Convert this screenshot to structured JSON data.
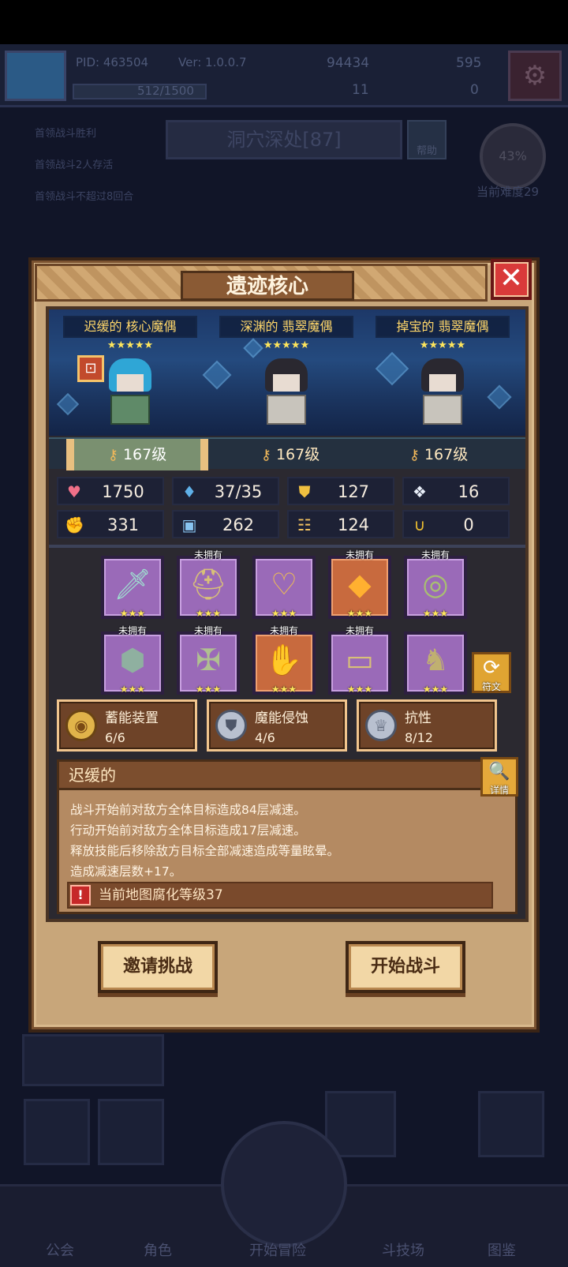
{
  "background": {
    "pid": "PID: 463504",
    "version": "Ver: 1.0.0.7",
    "gold": "94434",
    "gems": "595",
    "exp": "512/1500",
    "keys": "11",
    "tickets": "0",
    "quests": [
      "首领战斗胜利",
      "首领战斗2人存活",
      "首领战斗不超过8回合"
    ],
    "stage_title": "洞穴深处[87]",
    "help_label": "帮助",
    "progress_percent": "43%",
    "difficulty": "当前难度29",
    "nav": [
      "公会",
      "角色",
      "开始冒险",
      "斗技场",
      "图鉴"
    ]
  },
  "dialog": {
    "title": "遗迹核心",
    "bosses": [
      {
        "name": "迟缓的 核心魔偶",
        "stars": "★★★★★",
        "level": "167级",
        "selected": true
      },
      {
        "name": "深渊的 翡翠魔偶",
        "stars": "★★★★★",
        "level": "167级",
        "selected": false
      },
      {
        "name": "掉宝的 翡翠魔偶",
        "stars": "★★★★★",
        "level": "167级",
        "selected": false
      }
    ],
    "stats": [
      {
        "icon": "heart-icon",
        "glyph": "♥",
        "color": "#f07088",
        "value": "1750"
      },
      {
        "icon": "mana-drop-icon",
        "glyph": "💧",
        "color": "#5fb0e8",
        "value": "37/35"
      },
      {
        "icon": "shield-icon",
        "glyph": "⛊",
        "color": "#f0c040",
        "value": "127"
      },
      {
        "icon": "feather-icon",
        "glyph": "❖",
        "color": "#e8eef8",
        "value": "16"
      },
      {
        "icon": "fist-icon",
        "glyph": "✊",
        "color": "#f08a70",
        "value": "331"
      },
      {
        "icon": "book-icon",
        "glyph": "📖",
        "color": "#88c4f0",
        "value": "262"
      },
      {
        "icon": "scroll-icon",
        "glyph": "☷",
        "color": "#f0c060",
        "value": "124"
      },
      {
        "icon": "horseshoe-icon",
        "glyph": "∪",
        "color": "#f0c030",
        "value": "0"
      }
    ],
    "equipment": [
      {
        "name": "sword",
        "glyph": "🗡",
        "owned_label": "",
        "rarity": "purple",
        "stars": "★★★"
      },
      {
        "name": "helmet",
        "glyph": "⛑",
        "owned_label": "未拥有",
        "rarity": "purple",
        "stars": "★★★"
      },
      {
        "name": "necklace",
        "glyph": "♡",
        "owned_label": "",
        "rarity": "purple",
        "stars": "★★★"
      },
      {
        "name": "gem",
        "glyph": "◆",
        "owned_label": "未拥有",
        "rarity": "orange",
        "stars": "★★★"
      },
      {
        "name": "ring",
        "glyph": "◎",
        "owned_label": "未拥有",
        "rarity": "purple",
        "stars": "★★★"
      },
      {
        "name": "mask",
        "glyph": "⬢",
        "owned_label": "未拥有",
        "rarity": "purple",
        "stars": "★★★"
      },
      {
        "name": "armor",
        "glyph": "✠",
        "owned_label": "未拥有",
        "rarity": "purple",
        "stars": "★★★"
      },
      {
        "name": "gloves",
        "glyph": "✋",
        "owned_label": "未拥有",
        "rarity": "orange",
        "stars": "★★★"
      },
      {
        "name": "belt",
        "glyph": "▭",
        "owned_label": "未拥有",
        "rarity": "purple",
        "stars": "★★★"
      },
      {
        "name": "boots",
        "glyph": "♞",
        "owned_label": "",
        "rarity": "purple",
        "stars": "★★★"
      }
    ],
    "rune_label": "符文",
    "skills": [
      {
        "name": "蓄能装置",
        "count": "6/6",
        "style": "gold"
      },
      {
        "name": "魔能侵蚀",
        "count": "4/6",
        "style": "silver"
      },
      {
        "name": "抗性",
        "count": "8/12",
        "style": "silver"
      }
    ],
    "trait": {
      "title": "迟缓的",
      "detail_label": "详情",
      "lines": [
        "战斗开始前对敌方全体目标造成84层减速。",
        "行动开始前对敌方全体目标造成17层减速。",
        "释放技能后移除敌方目标全部减速造成等量眩晕。",
        "造成减速层数+17。"
      ],
      "warning": "当前地图腐化等级37"
    },
    "buttons": {
      "invite": "邀请挑战",
      "start": "开始战斗"
    },
    "colors": {
      "frame": "#c8a67a",
      "close": "#d93a3a",
      "purple_slot": "#9a6ab8",
      "orange_slot": "#c86a3e"
    }
  }
}
